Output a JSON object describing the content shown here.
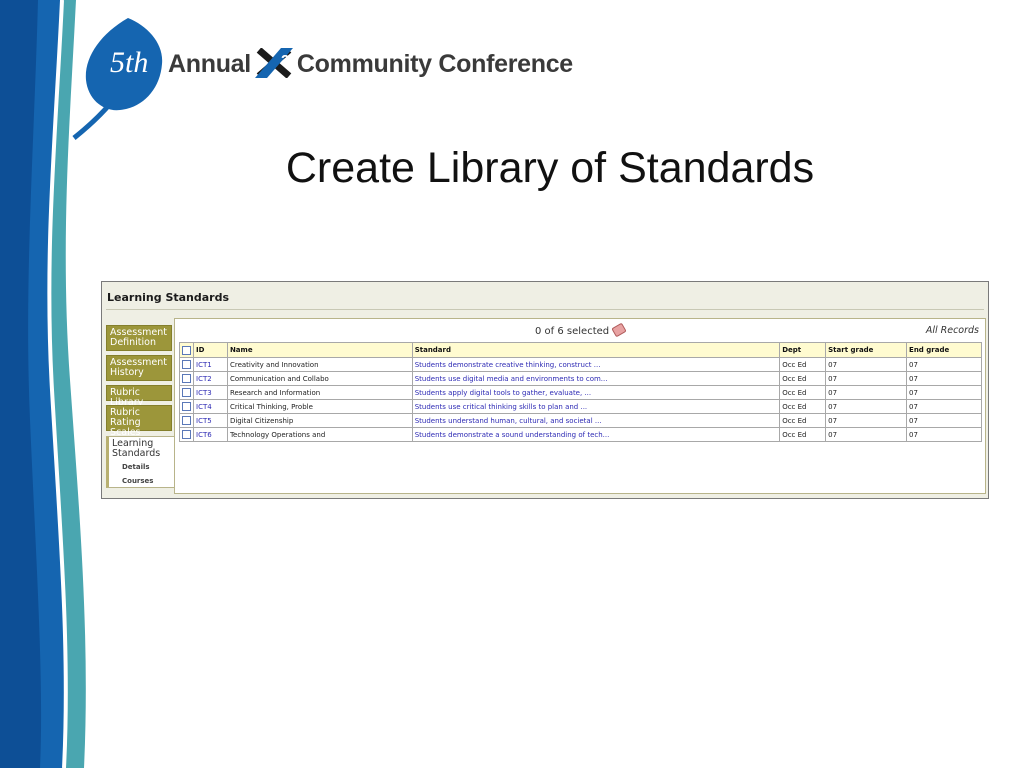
{
  "logo": {
    "superscript": "5th",
    "text_before": "Annual",
    "text_after": "Community Conference"
  },
  "slide_title": "Create Library of Standards",
  "panel": {
    "title": "Learning Standards",
    "side_tabs": [
      {
        "label": "Assessment Definition"
      },
      {
        "label": "Assessment History"
      },
      {
        "label": "Rubric Library"
      },
      {
        "label": "Rubric Rating Scales"
      },
      {
        "label": "Learning Standards",
        "active": true,
        "subitems": [
          "Details",
          "Courses"
        ]
      }
    ],
    "selection_text": "0 of 6 selected",
    "view_label": "All Records",
    "columns": [
      "ID",
      "Name",
      "Standard",
      "Dept",
      "Start grade",
      "End grade"
    ],
    "rows": [
      {
        "id": "ICT1",
        "name": "Creativity and Innovation",
        "standard": "Students demonstrate creative thinking, construct ...",
        "dept": "Occ Ed",
        "start": "07",
        "end": "07"
      },
      {
        "id": "ICT2",
        "name": "Communication and Collabo",
        "standard": "Students use digital media and environments to com...",
        "dept": "Occ Ed",
        "start": "07",
        "end": "07"
      },
      {
        "id": "ICT3",
        "name": "Research and Information",
        "standard": "Students apply digital tools to gather, evaluate, ...",
        "dept": "Occ Ed",
        "start": "07",
        "end": "07"
      },
      {
        "id": "ICT4",
        "name": "Critical Thinking, Proble",
        "standard": "Students use critical thinking skills to plan and ...",
        "dept": "Occ Ed",
        "start": "07",
        "end": "07"
      },
      {
        "id": "ICT5",
        "name": "Digital Citizenship",
        "standard": "Students understand human, cultural, and societal ...",
        "dept": "Occ Ed",
        "start": "07",
        "end": "07"
      },
      {
        "id": "ICT6",
        "name": "Technology Operations and",
        "standard": "Students demonstrate a sound understanding of tech...",
        "dept": "Occ Ed",
        "start": "07",
        "end": "07"
      }
    ]
  },
  "colors": {
    "brand_blue": "#1565b0",
    "teal": "#4aa6b0",
    "tab_olive": "#9c963a",
    "header_yellow": "#fffbd0",
    "link_blue": "#2d2ab4"
  }
}
